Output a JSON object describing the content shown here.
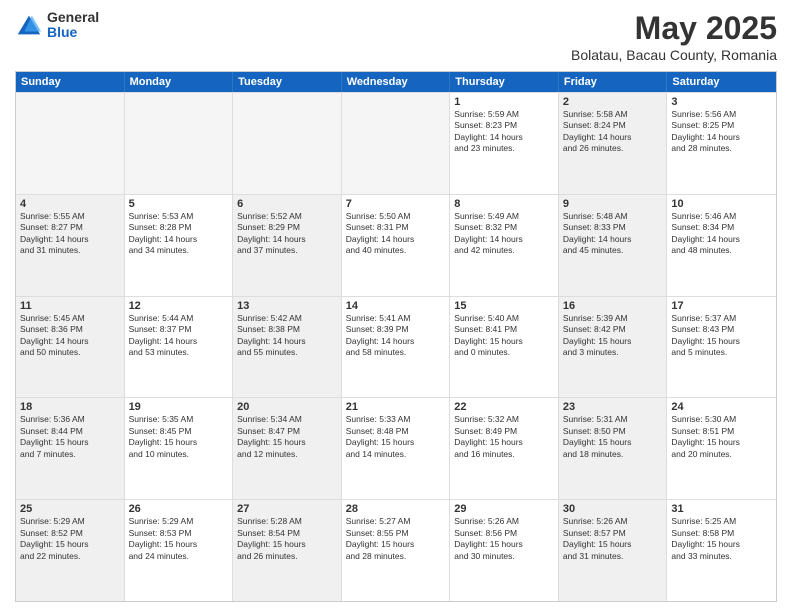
{
  "header": {
    "logo_general": "General",
    "logo_blue": "Blue",
    "title": "May 2025",
    "subtitle": "Bolatau, Bacau County, Romania"
  },
  "days": [
    "Sunday",
    "Monday",
    "Tuesday",
    "Wednesday",
    "Thursday",
    "Friday",
    "Saturday"
  ],
  "rows": [
    [
      {
        "day": "",
        "info": "",
        "empty": true
      },
      {
        "day": "",
        "info": "",
        "empty": true
      },
      {
        "day": "",
        "info": "",
        "empty": true
      },
      {
        "day": "",
        "info": "",
        "empty": true
      },
      {
        "day": "1",
        "info": "Sunrise: 5:59 AM\nSunset: 8:23 PM\nDaylight: 14 hours\nand 23 minutes.",
        "shaded": false
      },
      {
        "day": "2",
        "info": "Sunrise: 5:58 AM\nSunset: 8:24 PM\nDaylight: 14 hours\nand 26 minutes.",
        "shaded": true
      },
      {
        "day": "3",
        "info": "Sunrise: 5:56 AM\nSunset: 8:25 PM\nDaylight: 14 hours\nand 28 minutes.",
        "shaded": false
      }
    ],
    [
      {
        "day": "4",
        "info": "Sunrise: 5:55 AM\nSunset: 8:27 PM\nDaylight: 14 hours\nand 31 minutes.",
        "shaded": true
      },
      {
        "day": "5",
        "info": "Sunrise: 5:53 AM\nSunset: 8:28 PM\nDaylight: 14 hours\nand 34 minutes.",
        "shaded": false
      },
      {
        "day": "6",
        "info": "Sunrise: 5:52 AM\nSunset: 8:29 PM\nDaylight: 14 hours\nand 37 minutes.",
        "shaded": true
      },
      {
        "day": "7",
        "info": "Sunrise: 5:50 AM\nSunset: 8:31 PM\nDaylight: 14 hours\nand 40 minutes.",
        "shaded": false
      },
      {
        "day": "8",
        "info": "Sunrise: 5:49 AM\nSunset: 8:32 PM\nDaylight: 14 hours\nand 42 minutes.",
        "shaded": false
      },
      {
        "day": "9",
        "info": "Sunrise: 5:48 AM\nSunset: 8:33 PM\nDaylight: 14 hours\nand 45 minutes.",
        "shaded": true
      },
      {
        "day": "10",
        "info": "Sunrise: 5:46 AM\nSunset: 8:34 PM\nDaylight: 14 hours\nand 48 minutes.",
        "shaded": false
      }
    ],
    [
      {
        "day": "11",
        "info": "Sunrise: 5:45 AM\nSunset: 8:36 PM\nDaylight: 14 hours\nand 50 minutes.",
        "shaded": true
      },
      {
        "day": "12",
        "info": "Sunrise: 5:44 AM\nSunset: 8:37 PM\nDaylight: 14 hours\nand 53 minutes.",
        "shaded": false
      },
      {
        "day": "13",
        "info": "Sunrise: 5:42 AM\nSunset: 8:38 PM\nDaylight: 14 hours\nand 55 minutes.",
        "shaded": true
      },
      {
        "day": "14",
        "info": "Sunrise: 5:41 AM\nSunset: 8:39 PM\nDaylight: 14 hours\nand 58 minutes.",
        "shaded": false
      },
      {
        "day": "15",
        "info": "Sunrise: 5:40 AM\nSunset: 8:41 PM\nDaylight: 15 hours\nand 0 minutes.",
        "shaded": false
      },
      {
        "day": "16",
        "info": "Sunrise: 5:39 AM\nSunset: 8:42 PM\nDaylight: 15 hours\nand 3 minutes.",
        "shaded": true
      },
      {
        "day": "17",
        "info": "Sunrise: 5:37 AM\nSunset: 8:43 PM\nDaylight: 15 hours\nand 5 minutes.",
        "shaded": false
      }
    ],
    [
      {
        "day": "18",
        "info": "Sunrise: 5:36 AM\nSunset: 8:44 PM\nDaylight: 15 hours\nand 7 minutes.",
        "shaded": true
      },
      {
        "day": "19",
        "info": "Sunrise: 5:35 AM\nSunset: 8:45 PM\nDaylight: 15 hours\nand 10 minutes.",
        "shaded": false
      },
      {
        "day": "20",
        "info": "Sunrise: 5:34 AM\nSunset: 8:47 PM\nDaylight: 15 hours\nand 12 minutes.",
        "shaded": true
      },
      {
        "day": "21",
        "info": "Sunrise: 5:33 AM\nSunset: 8:48 PM\nDaylight: 15 hours\nand 14 minutes.",
        "shaded": false
      },
      {
        "day": "22",
        "info": "Sunrise: 5:32 AM\nSunset: 8:49 PM\nDaylight: 15 hours\nand 16 minutes.",
        "shaded": false
      },
      {
        "day": "23",
        "info": "Sunrise: 5:31 AM\nSunset: 8:50 PM\nDaylight: 15 hours\nand 18 minutes.",
        "shaded": true
      },
      {
        "day": "24",
        "info": "Sunrise: 5:30 AM\nSunset: 8:51 PM\nDaylight: 15 hours\nand 20 minutes.",
        "shaded": false
      }
    ],
    [
      {
        "day": "25",
        "info": "Sunrise: 5:29 AM\nSunset: 8:52 PM\nDaylight: 15 hours\nand 22 minutes.",
        "shaded": true
      },
      {
        "day": "26",
        "info": "Sunrise: 5:29 AM\nSunset: 8:53 PM\nDaylight: 15 hours\nand 24 minutes.",
        "shaded": false
      },
      {
        "day": "27",
        "info": "Sunrise: 5:28 AM\nSunset: 8:54 PM\nDaylight: 15 hours\nand 26 minutes.",
        "shaded": true
      },
      {
        "day": "28",
        "info": "Sunrise: 5:27 AM\nSunset: 8:55 PM\nDaylight: 15 hours\nand 28 minutes.",
        "shaded": false
      },
      {
        "day": "29",
        "info": "Sunrise: 5:26 AM\nSunset: 8:56 PM\nDaylight: 15 hours\nand 30 minutes.",
        "shaded": false
      },
      {
        "day": "30",
        "info": "Sunrise: 5:26 AM\nSunset: 8:57 PM\nDaylight: 15 hours\nand 31 minutes.",
        "shaded": true
      },
      {
        "day": "31",
        "info": "Sunrise: 5:25 AM\nSunset: 8:58 PM\nDaylight: 15 hours\nand 33 minutes.",
        "shaded": false
      }
    ]
  ]
}
